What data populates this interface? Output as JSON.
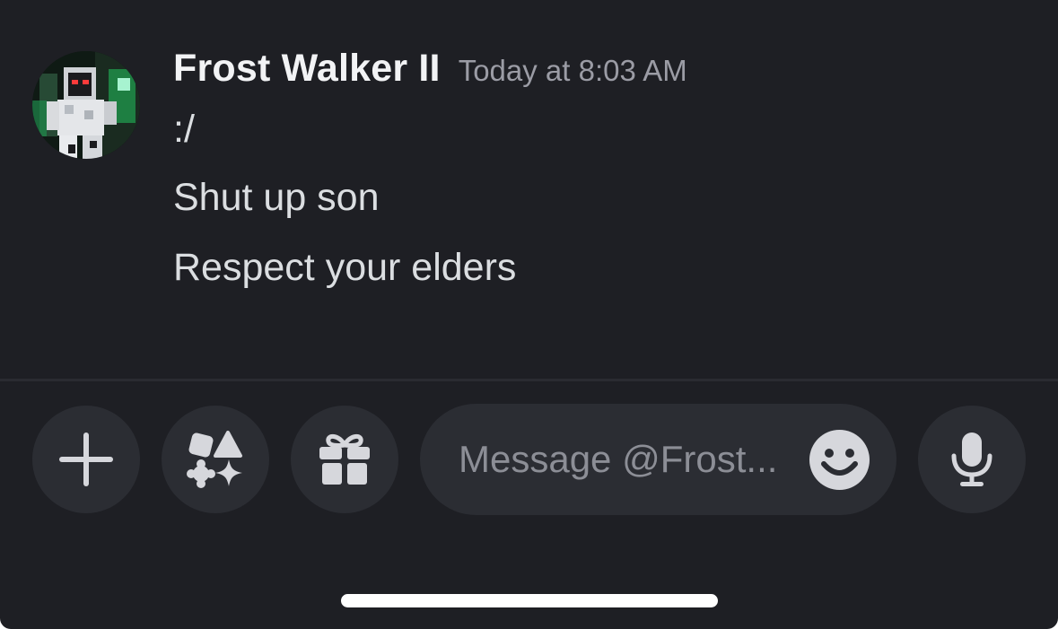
{
  "message": {
    "author": "Frost Walker II",
    "timestamp": "Today at 8:03 AM",
    "lines": [
      ":/",
      "Shut up son",
      "Respect your elders"
    ],
    "avatar_icon": "minecraft-skin-avatar"
  },
  "composer": {
    "placeholder": "Message @Frost...",
    "buttons": {
      "add": "plus-icon",
      "apps": "apps-shapes-icon",
      "gift": "gift-icon",
      "emoji": "smiley-icon",
      "voice": "microphone-icon"
    }
  },
  "colors": {
    "background": "#1e1f24",
    "button_bg": "#2b2d33",
    "username": "#f2f3f5",
    "text": "#dbdee1",
    "muted": "#9b9ca5",
    "icon": "#d6d7dc"
  }
}
